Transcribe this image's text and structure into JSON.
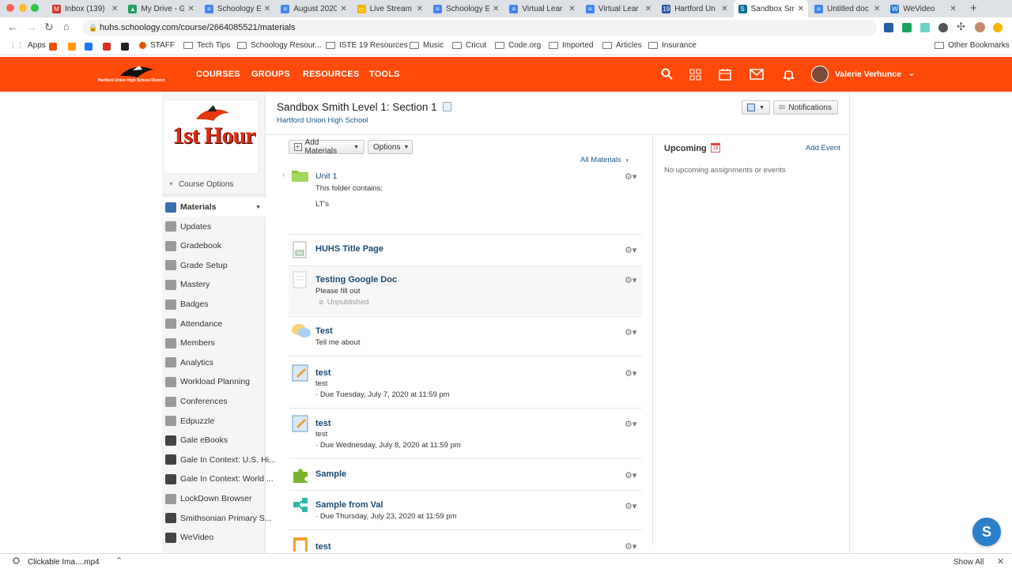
{
  "browser": {
    "tabs": [
      {
        "title": "Inbox (139)",
        "color": "#d93025",
        "glyph": "M"
      },
      {
        "title": "My Drive - G",
        "color": "#1fa463",
        "glyph": "▲"
      },
      {
        "title": "Schoology E",
        "color": "#4285f4",
        "glyph": "≡"
      },
      {
        "title": "August 2020",
        "color": "#4285f4",
        "glyph": "≡"
      },
      {
        "title": "Live Stream",
        "color": "#f4b400",
        "glyph": "▭"
      },
      {
        "title": "Schoology E",
        "color": "#4285f4",
        "glyph": "≡"
      },
      {
        "title": "Virtual Lear",
        "color": "#4285f4",
        "glyph": "≡"
      },
      {
        "title": "Virtual Lear",
        "color": "#4285f4",
        "glyph": "≡"
      },
      {
        "title": "Hartford Un",
        "color": "#2656a8",
        "glyph": "19"
      },
      {
        "title": "Sandbox Sm",
        "color": "#0c6b8f",
        "glyph": "S",
        "active": true
      },
      {
        "title": "Untitled doc",
        "color": "#4285f4",
        "glyph": "≡"
      },
      {
        "title": "WeVideo",
        "color": "#2b7bd6",
        "glyph": "W"
      }
    ],
    "url": "huhs.schoology.com/course/2664085521/materials",
    "bookmarks": [
      "Apps",
      "STAFF",
      "Tech Tips",
      "Schoology Resour...",
      "ISTE 19 Resources",
      "Music",
      "Cricut",
      "Code.org",
      "Imported",
      "Articles",
      "Insurance"
    ],
    "other_bookmarks": "Other Bookmarks",
    "download_file": "Clickable Ima....mp4",
    "show_all": "Show All"
  },
  "header": {
    "logo_text": "Hartford Union High School District",
    "nav": [
      "COURSES",
      "GROUPS",
      "RESOURCES",
      "TOOLS"
    ],
    "user_name": "Valerie Verhunce",
    "brand_color": "#ff4a0a"
  },
  "sidebar": {
    "course_image_text": "1st Hour",
    "course_options": "Course Options",
    "items": [
      {
        "label": "Materials",
        "color": "#3a6fb0"
      },
      {
        "label": "Updates",
        "color": "#9a9a9a"
      },
      {
        "label": "Gradebook",
        "color": "#9a9a9a"
      },
      {
        "label": "Grade Setup",
        "color": "#9a9a9a"
      },
      {
        "label": "Mastery",
        "color": "#9a9a9a"
      },
      {
        "label": "Badges",
        "color": "#9a9a9a"
      },
      {
        "label": "Attendance",
        "color": "#9a9a9a"
      },
      {
        "label": "Members",
        "color": "#9a9a9a"
      },
      {
        "label": "Analytics",
        "color": "#9a9a9a"
      },
      {
        "label": "Workload Planning",
        "color": "#9a9a9a"
      },
      {
        "label": "Conferences",
        "color": "#9a9a9a"
      },
      {
        "label": "Edpuzzle",
        "color": "#9a9a9a"
      },
      {
        "label": "Gale eBooks",
        "color": "#444444"
      },
      {
        "label": "Gale In Context: U.S. Hi...",
        "color": "#444444"
      },
      {
        "label": "Gale In Context: World ...",
        "color": "#444444"
      },
      {
        "label": "LockDown Browser",
        "color": "#9a9a9a"
      },
      {
        "label": "Smithsonian Primary S...",
        "color": "#444444"
      },
      {
        "label": "WeVideo",
        "color": "#444444"
      }
    ]
  },
  "course": {
    "title": "Sandbox Smith Level 1: Section 1",
    "school": "Hartford Union High School",
    "notifications": "Notifications"
  },
  "materials": {
    "add_materials": "Add Materials",
    "options": "Options",
    "filter": "All Materials",
    "folder": {
      "title": "Unit 1",
      "contains_label": "This folder contains:",
      "contents": "LT's"
    },
    "items": [
      {
        "title": "HUHS Title Page",
        "desc": "",
        "meta": ""
      },
      {
        "title": "Testing Google Doc",
        "desc": "Please fill out",
        "meta": "Unpublished"
      },
      {
        "title": "Test",
        "desc": "Tell me about",
        "meta": ""
      },
      {
        "title": "test",
        "desc": "test",
        "meta": "Due Tuesday, July 7, 2020 at 11:59 pm"
      },
      {
        "title": "test",
        "desc": "test",
        "meta": "Due Wednesday, July 8, 2020 at 11:59 pm"
      },
      {
        "title": "Sample",
        "desc": "",
        "meta": ""
      },
      {
        "title": "Sample from Val",
        "desc": "",
        "meta": "Due Thursday, July 23, 2020 at 11:59 pm"
      },
      {
        "title": "test",
        "desc": "",
        "meta": ""
      }
    ]
  },
  "upcoming": {
    "title": "Upcoming",
    "add_event": "Add Event",
    "empty": "No upcoming assignments or events"
  },
  "help_badge": "S"
}
